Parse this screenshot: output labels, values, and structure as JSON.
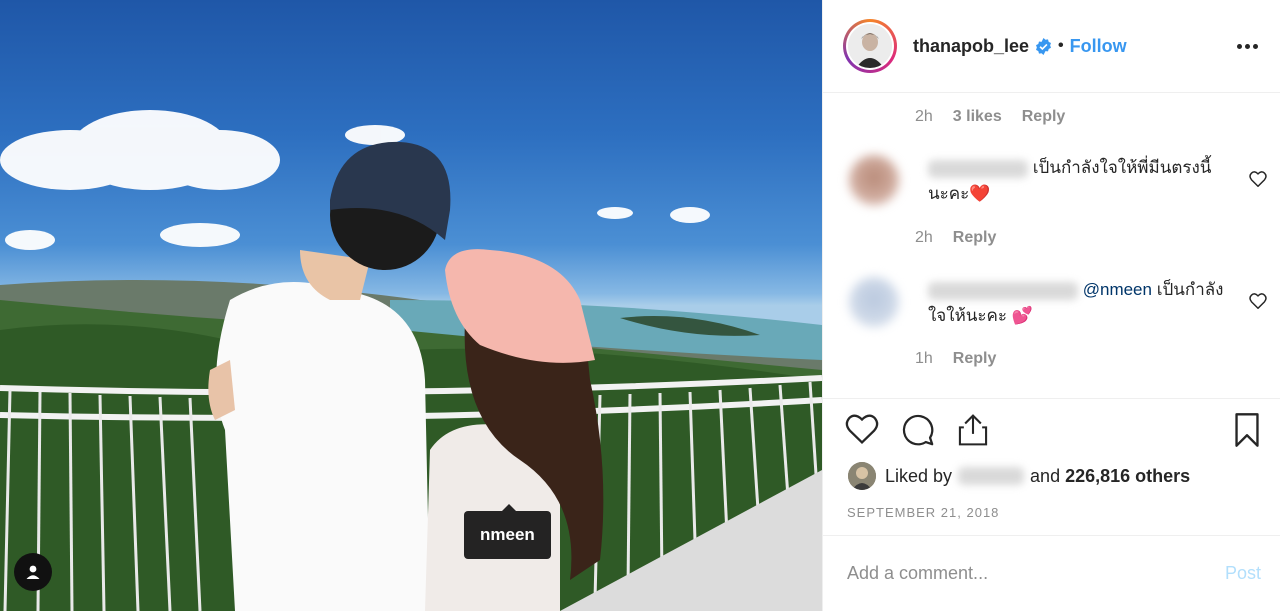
{
  "post": {
    "username": "thanapob_lee",
    "separator": "•",
    "follow_label": "Follow",
    "photo_tag": "nmeen"
  },
  "comments": [
    {
      "time": "2h",
      "likes": "3 likes",
      "reply": "Reply"
    },
    {
      "text": "เป็นกำลังใจให้พี่มีนตรงนี้นะคะ❤️",
      "time": "2h",
      "reply": "Reply"
    },
    {
      "mention": "@nmeen",
      "text": " เป็นกำลังใจให้นะคะ 💕",
      "time": "1h",
      "reply": "Reply"
    }
  ],
  "likes": {
    "prefix": "Liked by",
    "suffix": "and",
    "count": "226,816 others"
  },
  "date": "SEPTEMBER 21, 2018",
  "add_comment": {
    "placeholder": "Add a comment...",
    "post_label": "Post"
  },
  "colors": {
    "accent": "#3897f0",
    "post_disabled": "#b2dffc",
    "mention": "#003569",
    "secondary_text": "#8e8e8e"
  },
  "icons": [
    "user-tag-icon",
    "verified-badge-icon",
    "more-options-icon",
    "heart-icon",
    "comment-icon",
    "share-icon",
    "bookmark-icon",
    "small-heart-icon"
  ]
}
